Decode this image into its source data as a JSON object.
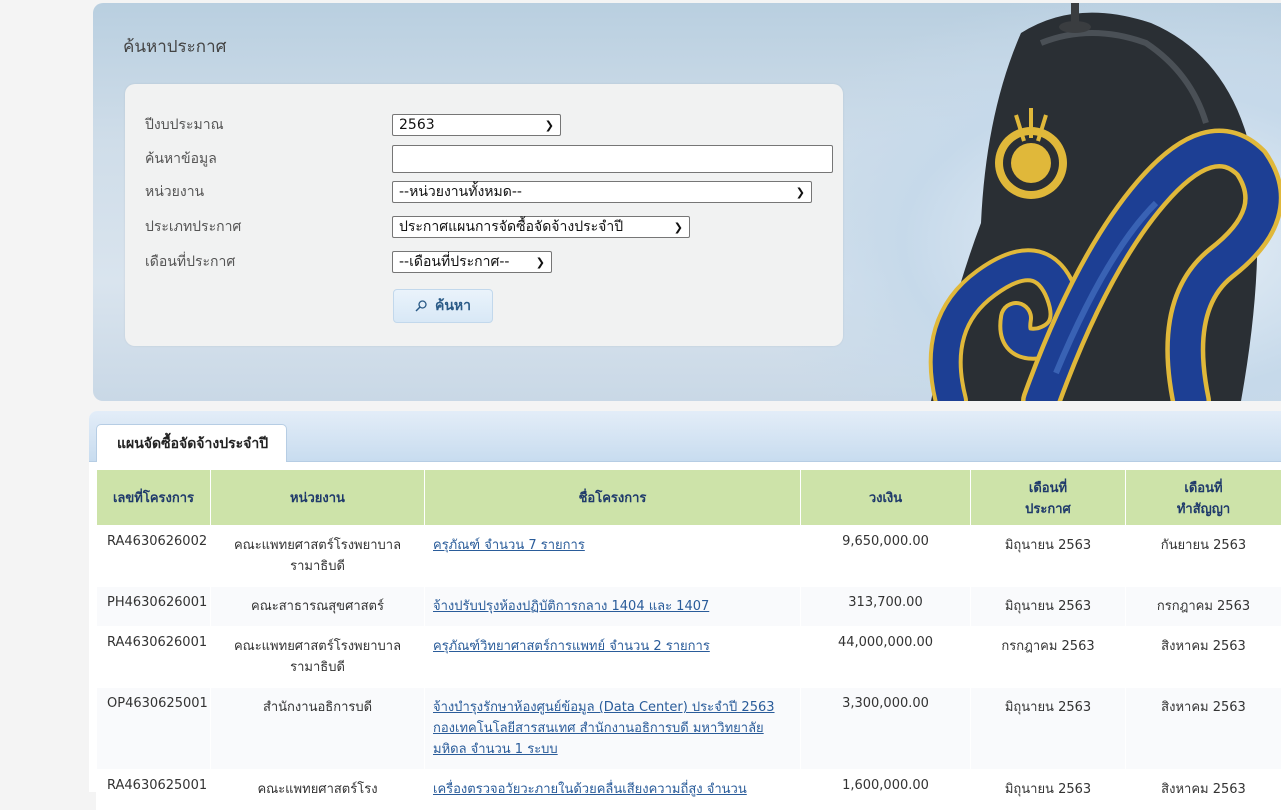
{
  "search": {
    "title": "ค้นหาประกาศ",
    "fields": {
      "year": {
        "label": "ปีงบประมาณ",
        "value": "2563"
      },
      "keyword": {
        "label": "ค้นหาข้อมูล",
        "value": ""
      },
      "department": {
        "label": "หน่วยงาน",
        "value": "--หน่วยงานทั้งหมด--"
      },
      "type": {
        "label": "ประเภทประกาศ",
        "value": "ประกาศแผนการจัดซื้อจัดจ้างประจำปี"
      },
      "month": {
        "label": "เดือนที่ประกาศ",
        "value": "--เดือนที่ประกาศ--"
      }
    },
    "button_label": "ค้นหา",
    "button_icon": "search-icon"
  },
  "results": {
    "tab_label": "แผนจัดซื้อจัดจ้างประจำปี",
    "headers": {
      "id": "เลขที่โครงการ",
      "dept": "หน่วยงาน",
      "name": "ชื่อโครงการ",
      "budget": "วงเงิน",
      "announce_month_1": "เดือนที่",
      "announce_month_2": "ประกาศ",
      "contract_month_1": "เดือนที่",
      "contract_month_2": "ทำสัญญา"
    },
    "rows": [
      {
        "id": "RA4630626002",
        "dept": "คณะแพทยศาสตร์โรงพยาบาลรามาธิบดี",
        "name": "ครุภัณฑ์ จำนวน 7 รายการ",
        "budget": "9,650,000.00",
        "announce": "มิถุนายน 2563",
        "contract": "กันยายน 2563"
      },
      {
        "id": "PH4630626001",
        "dept": "คณะสาธารณสุขศาสตร์",
        "name": "จ้างปรับปรุงห้องปฏิบัติการกลาง 1404 และ 1407",
        "budget": "313,700.00",
        "announce": "มิถุนายน 2563",
        "contract": "กรกฎาคม 2563"
      },
      {
        "id": "RA4630626001",
        "dept": "คณะแพทยศาสตร์โรงพยาบาลรามาธิบดี",
        "name": "ครุภัณฑ์วิทยาศาสตร์การแพทย์ จำนวน 2 รายการ",
        "budget": "44,000,000.00",
        "announce": "กรกฎาคม 2563",
        "contract": "สิงหาคม 2563"
      },
      {
        "id": "OP4630625001",
        "dept": "สำนักงานอธิการบดี",
        "name": "จ้างบำรุงรักษาห้องศูนย์ข้อมูล (Data Center) ประจำปี 2563 กองเทคโนโลยีสารสนเทศ สำนักงานอธิการบดี มหาวิทยาลัยมหิดล จำนวน 1 ระบบ",
        "budget": "3,300,000.00",
        "announce": "มิถุนายน 2563",
        "contract": "สิงหาคม 2563"
      },
      {
        "id": "RA4630625001",
        "dept": "คณะแพทยศาสตร์โรง",
        "name": "เครื่องตรวจอวัยวะภายในด้วยคลื่นเสียงความถี่สูง จำนวน",
        "budget": "1,600,000.00",
        "announce": "มิถุนายน 2563",
        "contract": "สิงหาคม 2563"
      }
    ]
  }
}
